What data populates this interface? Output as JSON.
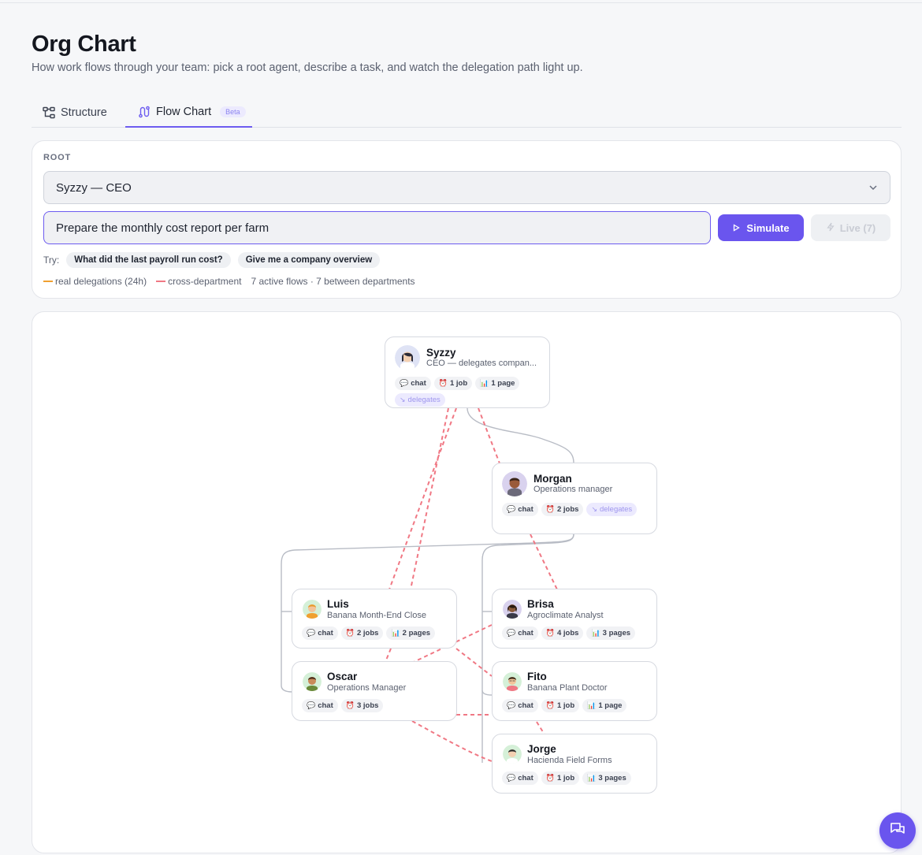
{
  "page": {
    "title": "Org Chart",
    "subtitle": "How work flows through your team: pick a root agent, describe a task, and watch the delegation path light up."
  },
  "tabs": [
    {
      "label": "Structure",
      "icon": "hierarchy-icon",
      "active": false
    },
    {
      "label": "Flow Chart",
      "icon": "flow-icon",
      "badge": "Beta",
      "active": true
    }
  ],
  "controls": {
    "root_label": "ROOT",
    "root_value": "Syzzy — CEO",
    "task_value": "Prepare the monthly cost report per farm",
    "simulate_label": "Simulate",
    "live_label": "Live (7)",
    "try_label": "Try:",
    "suggestions": [
      "What did the last payroll run cost?",
      "Give me a company overview"
    ]
  },
  "legend": {
    "real": "real delegations (24h)",
    "cross": "cross-department",
    "summary": "7 active flows · 7 between departments",
    "colors": {
      "real": "#f0a030",
      "cross": "#f07884",
      "structure": "#b8bcc5",
      "accent": "#6a55ee"
    }
  },
  "nodes": {
    "syzzy": {
      "name": "Syzzy",
      "role": "CEO — delegates compan...",
      "chat": "chat",
      "jobs": "1 job",
      "pages": "1 page",
      "delegates": "delegates"
    },
    "morgan": {
      "name": "Morgan",
      "role": "Operations manager",
      "chat": "chat",
      "jobs": "2 jobs",
      "delegates": "delegates"
    },
    "luis": {
      "name": "Luis",
      "role": "Banana Month-End Close",
      "chat": "chat",
      "jobs": "2 jobs",
      "pages": "2 pages"
    },
    "oscar": {
      "name": "Oscar",
      "role": "Operations Manager",
      "chat": "chat",
      "jobs": "3 jobs"
    },
    "brisa": {
      "name": "Brisa",
      "role": "Agroclimate Analyst",
      "chat": "chat",
      "jobs": "4 jobs",
      "pages": "3 pages"
    },
    "fito": {
      "name": "Fito",
      "role": "Banana Plant Doctor",
      "chat": "chat",
      "jobs": "1 job",
      "pages": "1 page"
    },
    "jorge": {
      "name": "Jorge",
      "role": "Hacienda Field Forms",
      "chat": "chat",
      "jobs": "1 job",
      "pages": "3 pages"
    }
  }
}
